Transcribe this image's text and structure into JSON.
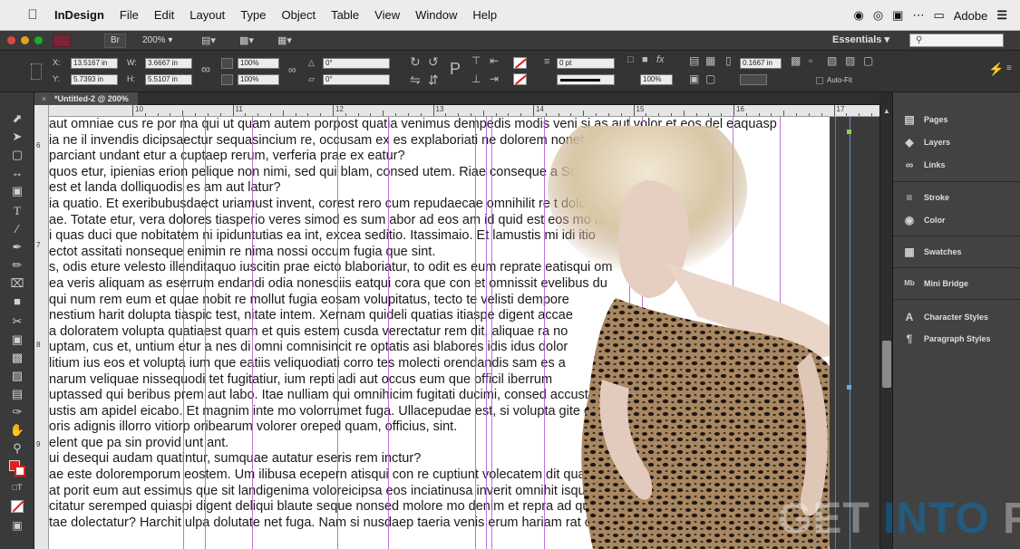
{
  "menubar": {
    "app": "InDesign",
    "items": [
      "File",
      "Edit",
      "Layout",
      "Type",
      "Object",
      "Table",
      "View",
      "Window",
      "Help"
    ],
    "right_label": "Adobe"
  },
  "appbar": {
    "bridge_label": "Br",
    "zoom": "200%",
    "workspace": "Essentials",
    "search_placeholder": ""
  },
  "control": {
    "x_label": "X:",
    "x_value": "13.5167 in",
    "y_label": "Y:",
    "y_value": "5.7393 in",
    "w_label": "W:",
    "w_value": "3.6667 in",
    "h_label": "H:",
    "h_value": "5.5107 in",
    "scale_x": "100%",
    "scale_y": "100%",
    "rotate": "0°",
    "shear": "0°",
    "stroke_weight": "0 pt",
    "opacity": "100%",
    "gutter": "0.1667 in",
    "autofit_label": "Auto-Fit"
  },
  "document": {
    "tab_label": "*Untitled-2 @ 200%"
  },
  "ruler": {
    "numbers": [
      "10",
      "11",
      "12",
      "13",
      "14",
      "15",
      "16",
      "17"
    ],
    "vertical": [
      "6",
      "7",
      "8",
      "9"
    ]
  },
  "text_lines": [
    "aut omniae cus re por ma qui ut quam autem porpost quatia venimus dempedis modis veni si as aut volor et eos del eaquasp",
    "ia ne il invendis dicipsaectur sequasincium re, occusam ex es explaboriati ne dolorem nonet el berrumquo mincit",
    "parciant undant etur a cuptaep rerum, verferia prae ex eatur?",
    "quos etur, ipienias erion pelique non nimi, sed qui blam, consed utem. Riae conseque a Soloruptias",
    "est et landa dolliquodis es am aut latur?",
    "ia quatio. Et exeribubusdaect uriamust invent, corest rero cum repudaecae omnihilit re t dolo conse",
    "ae. Totate etur, vera dolores tiasperio veres simod es sum abor ad eos am id quid est eos mo mossus",
    "i quas duci que nobitatem ni ipiduntutias ea int, excea seditio. Itassimaio. Et lamustis mi idi itio",
    "ectot assitati nonseque enimin re nima nossi occum fugia que sint.",
    "s, odis eture velesto illenditaquo iuscitin prae eicto blaboriatur, to odit es eum reprate eatisqui om",
    "ea veris aliquam as eserrum endandi odia nonesciis eatqui cora que con et omnissit evelibus du",
    " qui num rem eum et quae nobit re mollut fugia eosam volupitatus, tecto te velisti dempore",
    "nestium harit dolupta tiaspic test, nitate intem. Xernam quideli quatias itiaspe digent accae",
    "a doloratem volupta quatiaest quam et quis estem cusda verectatur rem dit, aliquae ra no",
    "uptam, cus et, untium etur a nes di omni comnisincit re optatis asi blabores idis idus dolor",
    "litium ius eos et volupta ium que eatiis veliquodiati corro tes molecti orendandis sam es a",
    "narum veliquae nissequodi tet fugitatiur, ium repti adi aut occus eum que officil iberrum",
    "uptassed qui beribus prem aut labo. Itae nulliam qui omnihicim fugitati ducimi, consed accust",
    "ustis am apidel eicabo. Et magnim inte mo volorrumet fuga. Ullacepudae est, si volupta gite dion",
    "oris adignis illorro vitiorp oribearum volorer oreped quam, officius, sint.",
    "elent que pa sin provid unt ant.",
    "ui desequi audam quatintur, sumquae autatur eseris rem inctur?",
    "ae este doloremporum eostem. Um ilibusa ecepern atisqui con re cuptiunt volecatem dit quas",
    "at porit eum aut essimus que sit landigenima voloreicipsa eos inciatinusa inverit omnihit isquunt re",
    "citatur seremped quiaspi digent deliqui blaute seque nonsed molore mo denim et repra ad qui re, s",
    "tae dolectatur? Harchit ulpa dolutate net fuga. Nam si nusdaep taeria venis erum hariam rat officiat"
  ],
  "panels": {
    "items": [
      "Pages",
      "Layers",
      "Links",
      "Stroke",
      "Color",
      "Swatches",
      "Mini Bridge",
      "Character Styles",
      "Paragraph Styles"
    ]
  },
  "watermark": {
    "part1": "GET",
    "part2": "INTO",
    "part3": "PC"
  },
  "colors": {
    "guide": "#b45ad2",
    "menubar": "#ececec",
    "panel_bg": "#424242",
    "canvas": "#ffffff"
  }
}
